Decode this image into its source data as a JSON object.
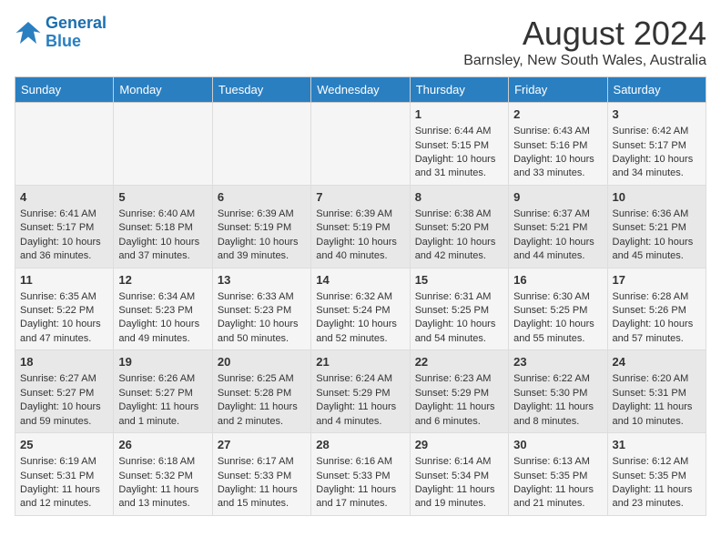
{
  "logo": {
    "line1": "General",
    "line2": "Blue"
  },
  "title": "August 2024",
  "subtitle": "Barnsley, New South Wales, Australia",
  "days_of_week": [
    "Sunday",
    "Monday",
    "Tuesday",
    "Wednesday",
    "Thursday",
    "Friday",
    "Saturday"
  ],
  "weeks": [
    [
      {
        "day": "",
        "info": ""
      },
      {
        "day": "",
        "info": ""
      },
      {
        "day": "",
        "info": ""
      },
      {
        "day": "",
        "info": ""
      },
      {
        "day": "1",
        "info": "Sunrise: 6:44 AM\nSunset: 5:15 PM\nDaylight: 10 hours\nand 31 minutes."
      },
      {
        "day": "2",
        "info": "Sunrise: 6:43 AM\nSunset: 5:16 PM\nDaylight: 10 hours\nand 33 minutes."
      },
      {
        "day": "3",
        "info": "Sunrise: 6:42 AM\nSunset: 5:17 PM\nDaylight: 10 hours\nand 34 minutes."
      }
    ],
    [
      {
        "day": "4",
        "info": "Sunrise: 6:41 AM\nSunset: 5:17 PM\nDaylight: 10 hours\nand 36 minutes."
      },
      {
        "day": "5",
        "info": "Sunrise: 6:40 AM\nSunset: 5:18 PM\nDaylight: 10 hours\nand 37 minutes."
      },
      {
        "day": "6",
        "info": "Sunrise: 6:39 AM\nSunset: 5:19 PM\nDaylight: 10 hours\nand 39 minutes."
      },
      {
        "day": "7",
        "info": "Sunrise: 6:39 AM\nSunset: 5:19 PM\nDaylight: 10 hours\nand 40 minutes."
      },
      {
        "day": "8",
        "info": "Sunrise: 6:38 AM\nSunset: 5:20 PM\nDaylight: 10 hours\nand 42 minutes."
      },
      {
        "day": "9",
        "info": "Sunrise: 6:37 AM\nSunset: 5:21 PM\nDaylight: 10 hours\nand 44 minutes."
      },
      {
        "day": "10",
        "info": "Sunrise: 6:36 AM\nSunset: 5:21 PM\nDaylight: 10 hours\nand 45 minutes."
      }
    ],
    [
      {
        "day": "11",
        "info": "Sunrise: 6:35 AM\nSunset: 5:22 PM\nDaylight: 10 hours\nand 47 minutes."
      },
      {
        "day": "12",
        "info": "Sunrise: 6:34 AM\nSunset: 5:23 PM\nDaylight: 10 hours\nand 49 minutes."
      },
      {
        "day": "13",
        "info": "Sunrise: 6:33 AM\nSunset: 5:23 PM\nDaylight: 10 hours\nand 50 minutes."
      },
      {
        "day": "14",
        "info": "Sunrise: 6:32 AM\nSunset: 5:24 PM\nDaylight: 10 hours\nand 52 minutes."
      },
      {
        "day": "15",
        "info": "Sunrise: 6:31 AM\nSunset: 5:25 PM\nDaylight: 10 hours\nand 54 minutes."
      },
      {
        "day": "16",
        "info": "Sunrise: 6:30 AM\nSunset: 5:25 PM\nDaylight: 10 hours\nand 55 minutes."
      },
      {
        "day": "17",
        "info": "Sunrise: 6:28 AM\nSunset: 5:26 PM\nDaylight: 10 hours\nand 57 minutes."
      }
    ],
    [
      {
        "day": "18",
        "info": "Sunrise: 6:27 AM\nSunset: 5:27 PM\nDaylight: 10 hours\nand 59 minutes."
      },
      {
        "day": "19",
        "info": "Sunrise: 6:26 AM\nSunset: 5:27 PM\nDaylight: 11 hours\nand 1 minute."
      },
      {
        "day": "20",
        "info": "Sunrise: 6:25 AM\nSunset: 5:28 PM\nDaylight: 11 hours\nand 2 minutes."
      },
      {
        "day": "21",
        "info": "Sunrise: 6:24 AM\nSunset: 5:29 PM\nDaylight: 11 hours\nand 4 minutes."
      },
      {
        "day": "22",
        "info": "Sunrise: 6:23 AM\nSunset: 5:29 PM\nDaylight: 11 hours\nand 6 minutes."
      },
      {
        "day": "23",
        "info": "Sunrise: 6:22 AM\nSunset: 5:30 PM\nDaylight: 11 hours\nand 8 minutes."
      },
      {
        "day": "24",
        "info": "Sunrise: 6:20 AM\nSunset: 5:31 PM\nDaylight: 11 hours\nand 10 minutes."
      }
    ],
    [
      {
        "day": "25",
        "info": "Sunrise: 6:19 AM\nSunset: 5:31 PM\nDaylight: 11 hours\nand 12 minutes."
      },
      {
        "day": "26",
        "info": "Sunrise: 6:18 AM\nSunset: 5:32 PM\nDaylight: 11 hours\nand 13 minutes."
      },
      {
        "day": "27",
        "info": "Sunrise: 6:17 AM\nSunset: 5:33 PM\nDaylight: 11 hours\nand 15 minutes."
      },
      {
        "day": "28",
        "info": "Sunrise: 6:16 AM\nSunset: 5:33 PM\nDaylight: 11 hours\nand 17 minutes."
      },
      {
        "day": "29",
        "info": "Sunrise: 6:14 AM\nSunset: 5:34 PM\nDaylight: 11 hours\nand 19 minutes."
      },
      {
        "day": "30",
        "info": "Sunrise: 6:13 AM\nSunset: 5:35 PM\nDaylight: 11 hours\nand 21 minutes."
      },
      {
        "day": "31",
        "info": "Sunrise: 6:12 AM\nSunset: 5:35 PM\nDaylight: 11 hours\nand 23 minutes."
      }
    ]
  ]
}
